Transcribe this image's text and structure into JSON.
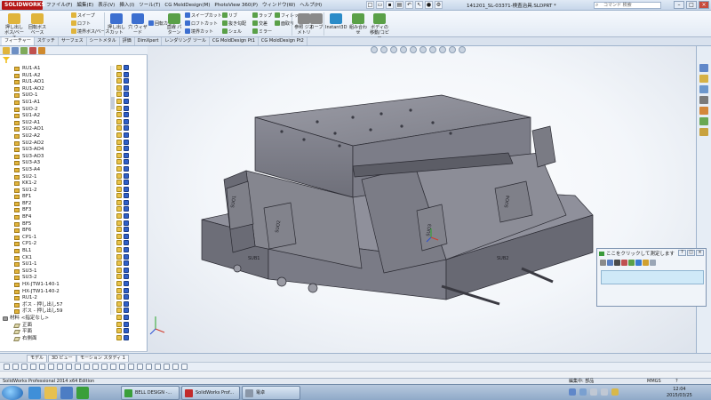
{
  "titlebar": {
    "logo": "SOLIDWORKS",
    "menus": [
      "ファイル(F)",
      "編集(E)",
      "表示(V)",
      "挿入(I)",
      "ツール(T)",
      "CG MoldDesign(M)",
      "PhotoView 360(P)",
      "ウィンドウ(W)",
      "ヘルプ(H)"
    ],
    "document": "141201_SL-03371-検査治具.SLDPRT *",
    "search_placeholder": "コマンド 検索",
    "win_controls": [
      "–",
      "□",
      "×"
    ]
  },
  "ribbon": {
    "big_buttons": [
      {
        "label": "押し出し ボス/ベース",
        "icon": "extrude-boss-icon",
        "color": "#e0b43c"
      },
      {
        "label": "回転ボス ベース",
        "icon": "revolve-boss-icon",
        "color": "#e0b43c"
      },
      {
        "label": "スイープ",
        "icon": "sweep-icon",
        "color": "#e0b43c"
      },
      {
        "label": "押し出し カット",
        "icon": "extrude-cut-icon",
        "color": "#3c6fd0"
      },
      {
        "label": "穴 ウィザード",
        "icon": "hole-wizard-icon",
        "color": "#3c6fd0"
      },
      {
        "label": "回転カット",
        "icon": "revolve-cut-icon",
        "color": "#3c6fd0"
      },
      {
        "label": "直線 パターン",
        "icon": "linear-pattern-icon",
        "color": "#5aa048"
      },
      {
        "label": "フィレット",
        "icon": "fillet-icon",
        "color": "#5aa048"
      },
      {
        "label": "リブ",
        "icon": "rib-icon",
        "color": "#5aa048"
      },
      {
        "label": "参照 ジオメトリ",
        "icon": "reference-geometry-icon",
        "color": "#8a8a8a"
      },
      {
        "label": "カーブ",
        "icon": "curves-icon",
        "color": "#8a8a8a"
      },
      {
        "label": "Instant3D",
        "icon": "instant3d-icon",
        "color": "#2a8bc8"
      },
      {
        "label": "組み合わせ",
        "icon": "combine-icon",
        "color": "#5aa048"
      },
      {
        "label": "ボディの 移動/コピー",
        "icon": "move-body-icon",
        "color": "#5aa048"
      }
    ],
    "small_buttons": [
      "ロフト",
      "境界ボス/ベース",
      "スイープカット",
      "ロフトカット",
      "境界カット",
      "抜き勾配",
      "シェル",
      "ラップ",
      "交差",
      "ミラー",
      "フィレット",
      "面取り"
    ]
  },
  "tabs": [
    "フィーチャー",
    "スケッチ",
    "サーフェス",
    "シートメタル",
    "評価",
    "DimXpert",
    "レンダリング ツール",
    "CG MoldDesign Pt1",
    "CG MoldDesign Pt2"
  ],
  "tree": [
    {
      "label": "RU1-A1"
    },
    {
      "label": "RU1-A2"
    },
    {
      "label": "RU1-AO1"
    },
    {
      "label": "RU1-AO2"
    },
    {
      "label": "SUO-1"
    },
    {
      "label": "SU1-A1"
    },
    {
      "label": "SUO-2"
    },
    {
      "label": "SU1-A2"
    },
    {
      "label": "SU2-A1"
    },
    {
      "label": "SU2-AO1"
    },
    {
      "label": "SU2-A2"
    },
    {
      "label": "SU2-AO2"
    },
    {
      "label": "SU3-AO4"
    },
    {
      "label": "SU3-AO3"
    },
    {
      "label": "SU3-A3"
    },
    {
      "label": "SU3-A4"
    },
    {
      "label": "SU2-1"
    },
    {
      "label": "KK1-2"
    },
    {
      "label": "SU1-2"
    },
    {
      "label": "BF1"
    },
    {
      "label": "BF2"
    },
    {
      "label": "BF3"
    },
    {
      "label": "BF4"
    },
    {
      "label": "BF5"
    },
    {
      "label": "BF6"
    },
    {
      "label": "CP1-1"
    },
    {
      "label": "CP1-2"
    },
    {
      "label": "BL1"
    },
    {
      "label": "CK1"
    },
    {
      "label": "SU1-1"
    },
    {
      "label": "SU3-1"
    },
    {
      "label": "SU3-2"
    },
    {
      "label": "HX-JTW1-140-1"
    },
    {
      "label": "HX-JTW1-140-2"
    },
    {
      "label": "RU1-2"
    },
    {
      "label": "ボス - 押し出し57"
    },
    {
      "label": "ボス - 押し出し59"
    }
  ],
  "tree_bottom": [
    {
      "label": "材料 <指定なし>",
      "kind": "mat"
    },
    {
      "label": "正面",
      "kind": "plane"
    },
    {
      "label": "平面",
      "kind": "plane"
    },
    {
      "label": "右側面",
      "kind": "plane"
    }
  ],
  "model": {
    "labels": [
      "SUO1",
      "SUO2",
      "SUO3",
      "SUO4",
      "SUB1",
      "SUB2",
      "SU2-1"
    ]
  },
  "measure": {
    "title": "ここをクリックして測定します",
    "buttons": [
      "?",
      "◫",
      "×"
    ]
  },
  "bottom_tabs": [
    "モデル",
    "3D ビュー",
    "モーション スタディ 1"
  ],
  "status": {
    "app": "SolidWorks Professional 2014 x64 Edition",
    "state": "編集中: 部品",
    "units": "MMGS",
    "help": "?"
  },
  "taskbar": {
    "buttons": [
      "BELL DESIGN -...",
      "SolidWorks Prof...",
      "電卓"
    ],
    "time": "12:04",
    "date": "2015/03/25"
  }
}
